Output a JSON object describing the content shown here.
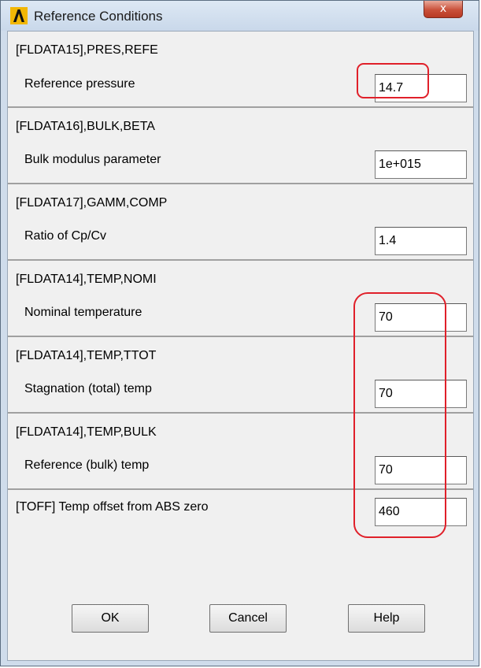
{
  "window": {
    "title": "Reference Conditions",
    "close_glyph": "x",
    "icon": "ansys-logo-icon"
  },
  "sections": [
    {
      "title": "[FLDATA15],PRES,REFE",
      "label": "Reference pressure",
      "value": "14.7"
    },
    {
      "title": "[FLDATA16],BULK,BETA",
      "label": "Bulk modulus parameter",
      "value": "1e+015"
    },
    {
      "title": "[FLDATA17],GAMM,COMP",
      "label": "Ratio of Cp/Cv",
      "value": "1.4"
    },
    {
      "title": "[FLDATA14],TEMP,NOMI",
      "label": "Nominal temperature",
      "value": "70"
    },
    {
      "title": "[FLDATA14],TEMP,TTOT",
      "label": "Stagnation (total) temp",
      "value": "70"
    },
    {
      "title": "[FLDATA14],TEMP,BULK",
      "label": "Reference (bulk) temp",
      "value": "70"
    }
  ],
  "toff": {
    "label": "[TOFF] Temp offset from ABS zero",
    "value": "460"
  },
  "buttons": {
    "ok": "OK",
    "cancel": "Cancel",
    "help": "Help"
  },
  "colors": {
    "annotation_red": "#e0202a",
    "dialog_bg": "#f0f0f0"
  }
}
